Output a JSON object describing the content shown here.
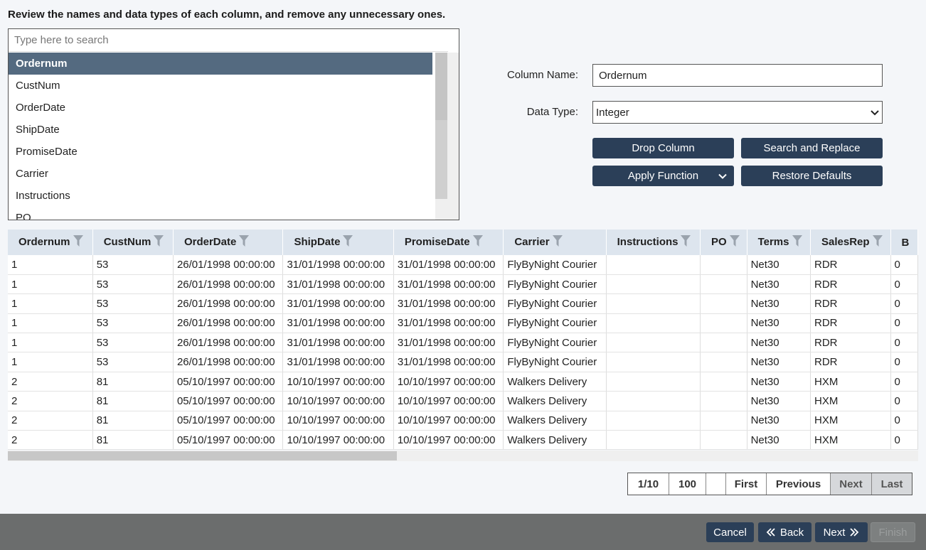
{
  "instructions": "Review the names and data types of each column, and remove any unnecessary ones.",
  "column_list": {
    "search_placeholder": "Type here to search",
    "items": [
      "Ordernum",
      "CustNum",
      "OrderDate",
      "ShipDate",
      "PromiseDate",
      "Carrier",
      "Instructions",
      "PO"
    ],
    "selected": "Ordernum"
  },
  "form": {
    "column_name_label": "Column Name:",
    "column_name_value": "Ordernum",
    "data_type_label": "Data Type:",
    "data_type_value": "Integer"
  },
  "buttons": {
    "drop_column": "Drop Column",
    "search_replace": "Search and Replace",
    "apply_function": "Apply Function",
    "restore_defaults": "Restore Defaults"
  },
  "grid": {
    "columns": [
      "Ordernum",
      "CustNum",
      "OrderDate",
      "ShipDate",
      "PromiseDate",
      "Carrier",
      "Instructions",
      "PO",
      "Terms",
      "SalesRep",
      "B"
    ],
    "rows": [
      [
        "1",
        "53",
        "26/01/1998 00:00:00",
        "31/01/1998 00:00:00",
        "31/01/1998 00:00:00",
        "FlyByNight Courier",
        "",
        "",
        "Net30",
        "RDR",
        "0"
      ],
      [
        "1",
        "53",
        "26/01/1998 00:00:00",
        "31/01/1998 00:00:00",
        "31/01/1998 00:00:00",
        "FlyByNight Courier",
        "",
        "",
        "Net30",
        "RDR",
        "0"
      ],
      [
        "1",
        "53",
        "26/01/1998 00:00:00",
        "31/01/1998 00:00:00",
        "31/01/1998 00:00:00",
        "FlyByNight Courier",
        "",
        "",
        "Net30",
        "RDR",
        "0"
      ],
      [
        "1",
        "53",
        "26/01/1998 00:00:00",
        "31/01/1998 00:00:00",
        "31/01/1998 00:00:00",
        "FlyByNight Courier",
        "",
        "",
        "Net30",
        "RDR",
        "0"
      ],
      [
        "1",
        "53",
        "26/01/1998 00:00:00",
        "31/01/1998 00:00:00",
        "31/01/1998 00:00:00",
        "FlyByNight Courier",
        "",
        "",
        "Net30",
        "RDR",
        "0"
      ],
      [
        "1",
        "53",
        "26/01/1998 00:00:00",
        "31/01/1998 00:00:00",
        "31/01/1998 00:00:00",
        "FlyByNight Courier",
        "",
        "",
        "Net30",
        "RDR",
        "0"
      ],
      [
        "2",
        "81",
        "05/10/1997 00:00:00",
        "10/10/1997 00:00:00",
        "10/10/1997 00:00:00",
        "Walkers Delivery",
        "",
        "",
        "Net30",
        "HXM",
        "0"
      ],
      [
        "2",
        "81",
        "05/10/1997 00:00:00",
        "10/10/1997 00:00:00",
        "10/10/1997 00:00:00",
        "Walkers Delivery",
        "",
        "",
        "Net30",
        "HXM",
        "0"
      ],
      [
        "2",
        "81",
        "05/10/1997 00:00:00",
        "10/10/1997 00:00:00",
        "10/10/1997 00:00:00",
        "Walkers Delivery",
        "",
        "",
        "Net30",
        "HXM",
        "0"
      ],
      [
        "2",
        "81",
        "05/10/1997 00:00:00",
        "10/10/1997 00:00:00",
        "10/10/1997 00:00:00",
        "Walkers Delivery",
        "",
        "",
        "Net30",
        "HXM",
        "0"
      ]
    ]
  },
  "pager": {
    "page": "1/10",
    "page_size": "100",
    "empty": "",
    "first": "First",
    "previous": "Previous",
    "next": "Next",
    "last": "Last"
  },
  "footer": {
    "cancel": "Cancel",
    "back": "Back",
    "next": "Next",
    "finish": "Finish"
  },
  "colors": {
    "accent": "#2b3f58",
    "selected_row": "#546a80",
    "header_bg": "#dde5ee",
    "footer_bg": "#6b6d6d"
  }
}
